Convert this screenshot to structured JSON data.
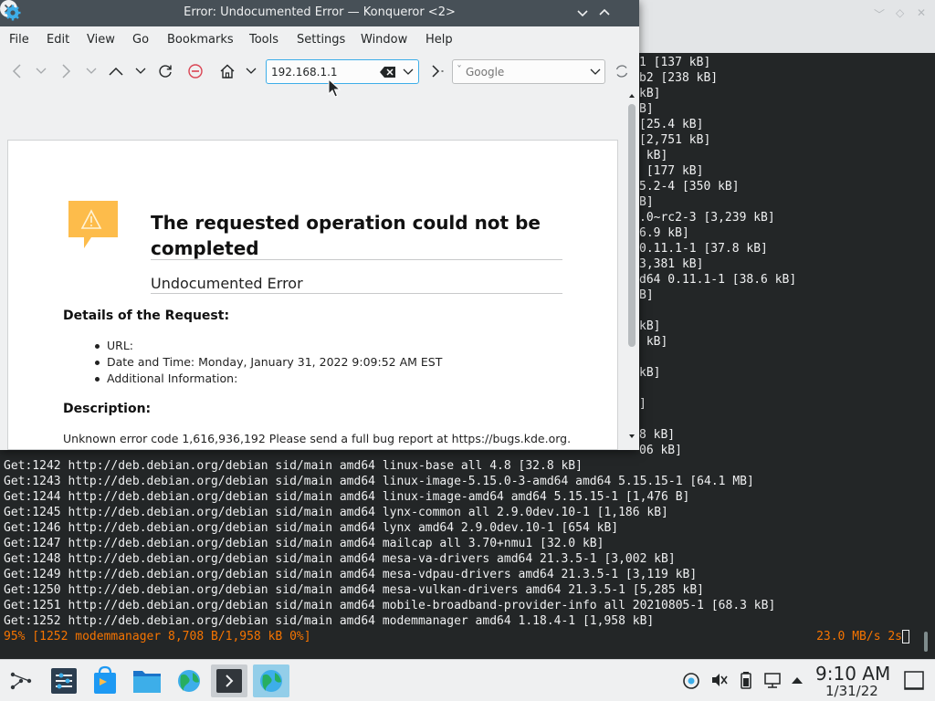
{
  "terminal": {
    "fragments": [
      {
        "text": "1 [137 kB]",
        "row": 0
      },
      {
        "text": "b2 [238 kB]",
        "row": 1
      },
      {
        "text": "kB]",
        "row": 2
      },
      {
        "text": "B]",
        "row": 3
      },
      {
        "text": "[25.4 kB]",
        "row": 4
      },
      {
        "text": "[2,751 kB]",
        "row": 5
      },
      {
        "text": " kB]",
        "row": 6
      },
      {
        "text": " [177 kB]",
        "row": 7
      },
      {
        "text": "5.2-4 [350 kB]",
        "row": 8
      },
      {
        "text": "B]",
        "row": 9
      },
      {
        "text": ".0~rc2-3 [3,239 kB]",
        "row": 10
      },
      {
        "text": "6.9 kB]",
        "row": 11
      },
      {
        "text": "0.11.1-1 [37.8 kB]",
        "row": 12
      },
      {
        "text": "3,381 kB]",
        "row": 13
      },
      {
        "text": "d64 0.11.1-1 [38.6 kB]",
        "row": 14
      },
      {
        "text": "B]",
        "row": 15
      },
      {
        "text": "kB]",
        "row": 17
      },
      {
        "text": " kB]",
        "row": 18
      },
      {
        "text": "kB]",
        "row": 20
      },
      {
        "text": "]",
        "row": 22
      },
      {
        "text": "8 kB]",
        "row": 24
      },
      {
        "text": "06 kB]",
        "row": 25
      }
    ],
    "lines": [
      {
        "text": "Get:1242 http://deb.debian.org/debian sid/main amd64 linux-base all 4.8 [32.8 kB]",
        "row": 26
      },
      {
        "text": "Get:1243 http://deb.debian.org/debian sid/main amd64 linux-image-5.15.0-3-amd64 amd64 5.15.15-1 [64.1 MB]",
        "row": 27
      },
      {
        "text": "Get:1244 http://deb.debian.org/debian sid/main amd64 linux-image-amd64 amd64 5.15.15-1 [1,476 B]",
        "row": 28
      },
      {
        "text": "Get:1245 http://deb.debian.org/debian sid/main amd64 lynx-common all 2.9.0dev.10-1 [1,186 kB]",
        "row": 29
      },
      {
        "text": "Get:1246 http://deb.debian.org/debian sid/main amd64 lynx amd64 2.9.0dev.10-1 [654 kB]",
        "row": 30
      },
      {
        "text": "Get:1247 http://deb.debian.org/debian sid/main amd64 mailcap all 3.70+nmu1 [32.0 kB]",
        "row": 31
      },
      {
        "text": "Get:1248 http://deb.debian.org/debian sid/main amd64 mesa-va-drivers amd64 21.3.5-1 [3,002 kB]",
        "row": 32
      },
      {
        "text": "Get:1249 http://deb.debian.org/debian sid/main amd64 mesa-vdpau-drivers amd64 21.3.5-1 [3,119 kB]",
        "row": 33
      },
      {
        "text": "Get:1250 http://deb.debian.org/debian sid/main amd64 mesa-vulkan-drivers amd64 21.3.5-1 [5,285 kB]",
        "row": 34
      },
      {
        "text": "Get:1251 http://deb.debian.org/debian sid/main amd64 mobile-broadband-provider-info all 20210805-1 [68.3 kB]",
        "row": 35
      },
      {
        "text": "Get:1252 http://deb.debian.org/debian sid/main amd64 modemmanager amd64 1.18.4-1 [1,958 kB]",
        "row": 36
      }
    ],
    "status": "95% [1252 modemmanager 8,708 B/1,958 kB 0%]",
    "speed": "23.0 MB/s 2s"
  },
  "konqueror": {
    "title": "Error: Undocumented Error — Konqueror <2>",
    "menu": [
      "File",
      "Edit",
      "View",
      "Go",
      "Bookmarks",
      "Tools",
      "Settings",
      "Window",
      "Help"
    ],
    "url": "192.168.1.1",
    "search_placeholder": "Google",
    "error": {
      "heading": "The requested operation could not be completed",
      "subheading": "Undocumented Error",
      "details_heading": "Details of the Request:",
      "details": [
        "URL:",
        "Date and Time: Monday, January 31, 2022 9:09:52 AM EST",
        "Additional Information:"
      ],
      "description_heading": "Description:",
      "description": "Unknown error code 1,616,936,192 Please send a full bug report at https://bugs.kde.org."
    }
  },
  "taskbar": {
    "time": "9:10 AM",
    "date": "1/31/22"
  },
  "colors": {
    "accent": "#3daee9",
    "warning": "#fdbc4b",
    "terminal_status": "#f67400"
  }
}
